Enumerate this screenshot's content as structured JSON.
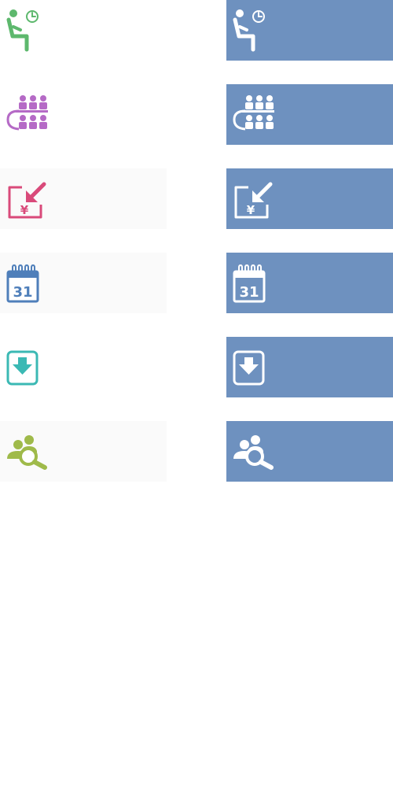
{
  "icons": {
    "r1": "waiting-person-clock-icon",
    "r2": "meeting-group-icon",
    "r3": "yen-payment-in-icon",
    "r4": "calendar-icon",
    "r5": "download-icon",
    "r6": "people-search-icon"
  },
  "colors": {
    "green": "#5db86d",
    "purple": "#b56ac6",
    "pink": "#d94a7a",
    "blue": "#4f7fba",
    "teal": "#3bb9b4",
    "olive": "#9fba4a",
    "active_bg": "#6e91bf",
    "inactive_bg": "#fafafa"
  },
  "calendar": {
    "day": "31"
  },
  "yen": {
    "symbol": "¥"
  }
}
